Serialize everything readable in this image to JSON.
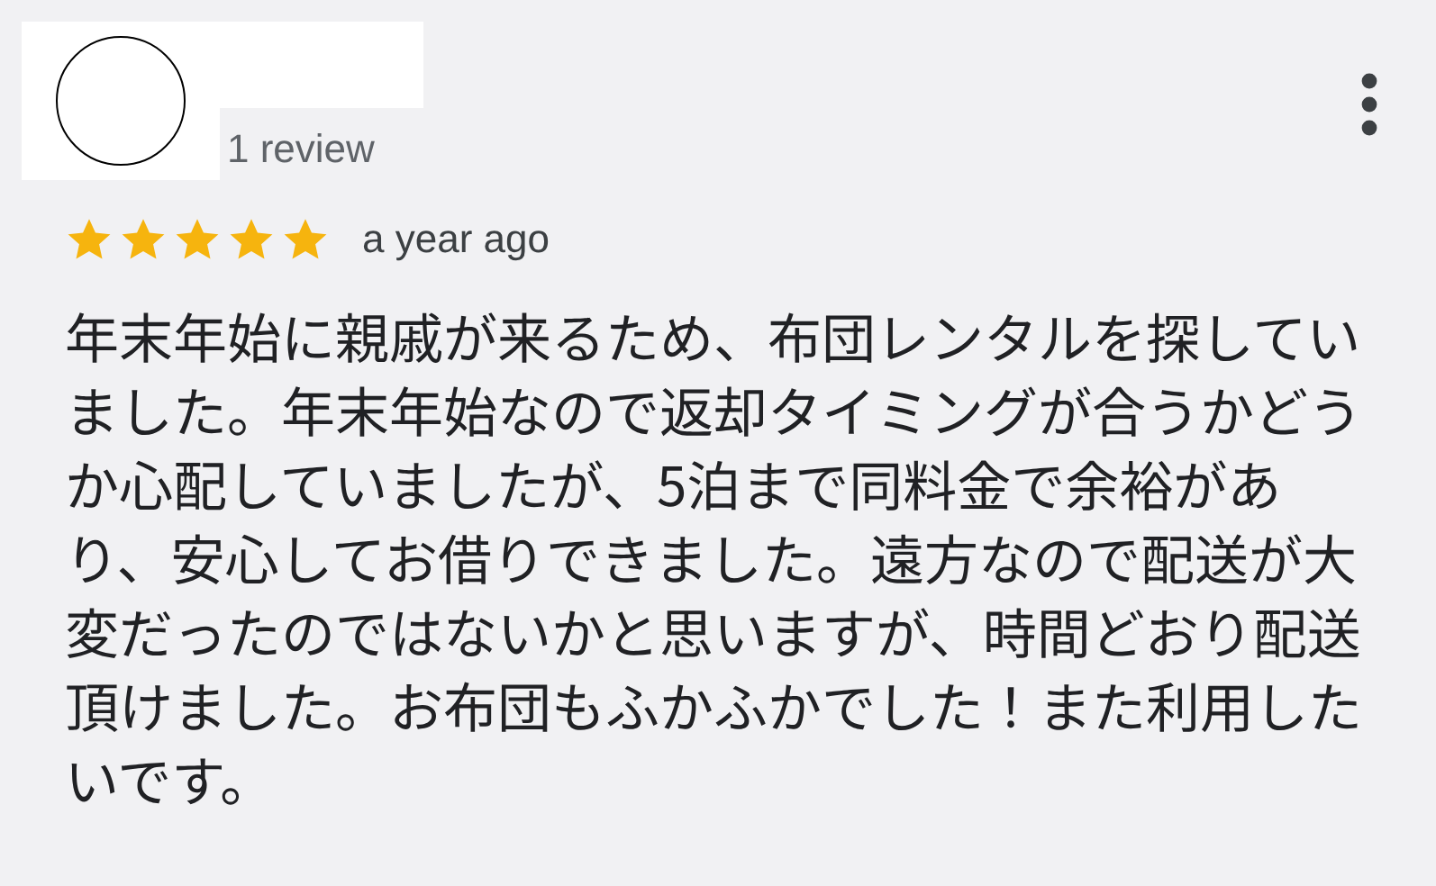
{
  "review": {
    "review_count": "1 review",
    "stars": 5,
    "time": "a year ago",
    "text": "年末年始に親戚が来るため、布団レンタルを探していました。年末年始なので返却タイミングが合うかどうか心配していましたが、5泊まで同料金で余裕があり、安心してお借りできました。遠方なので配送が大変だったのではないかと思いますが、時間どおり配送頂けました。お布団もふかふかでした！また利用したいです。"
  }
}
